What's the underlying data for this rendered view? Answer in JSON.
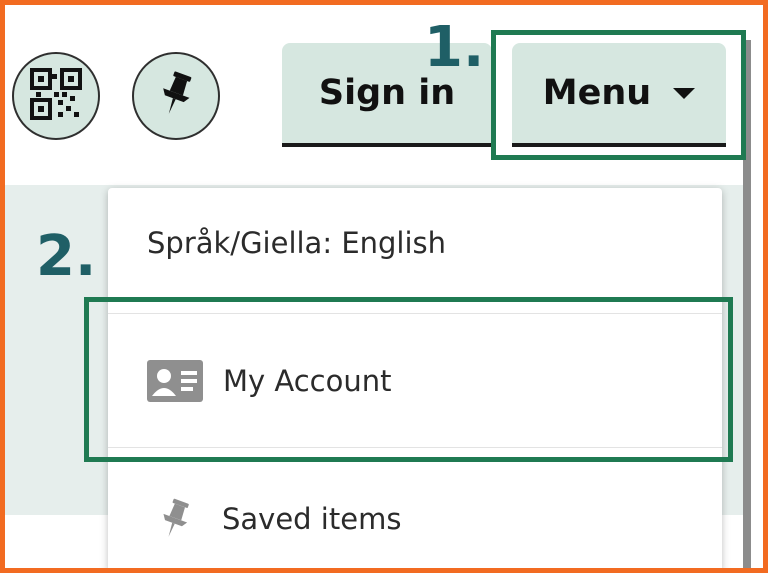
{
  "header": {
    "qr_icon": "qr-code-icon",
    "pin_icon": "pushpin-icon",
    "signin_label": "Sign in",
    "menu_label": "Menu",
    "menu_caret_icon": "caret-down-icon"
  },
  "steps": {
    "step1": "1.",
    "step2": "2."
  },
  "dropdown": {
    "language_label": "Språk/Giella: English",
    "account_icon": "id-card-icon",
    "account_label": "My Account",
    "saved_icon": "pushpin-icon",
    "saved_label": "Saved items"
  },
  "colors": {
    "frame": "#f26b21",
    "highlight": "#1f7a52",
    "step_number": "#1f5f66",
    "button_bg": "#d6e7e0"
  }
}
